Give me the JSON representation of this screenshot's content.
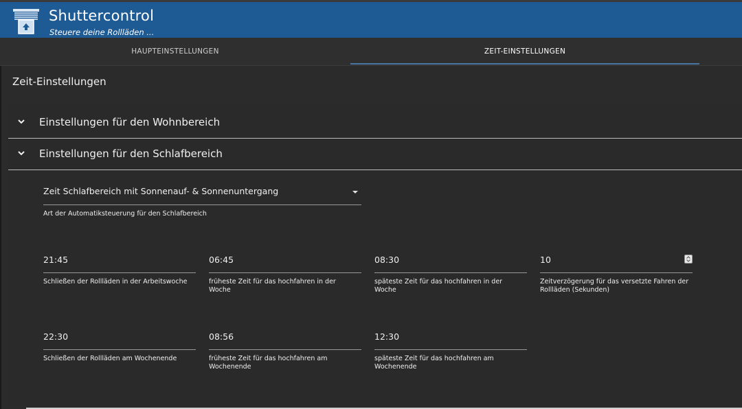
{
  "app": {
    "title": "Shuttercontrol",
    "subtitle": "Steuere deine Rollläden ...",
    "logo_icon": "blinds-up-icon"
  },
  "tabs": [
    {
      "label": "HAUPTEINSTELLUNGEN",
      "active": false
    },
    {
      "label": "ZEIT-EINSTELLUNGEN",
      "active": true
    }
  ],
  "page": {
    "title": "Zeit-Einstellungen"
  },
  "sections": {
    "living": {
      "label": "Einstellungen für den Wohnbereich",
      "icon": "chevron-down-icon"
    },
    "sleep": {
      "label": "Einstellungen für den Schlafbereich",
      "icon": "chevron-down-icon"
    }
  },
  "sleep": {
    "mode_select": {
      "value": "Zeit Schlafbereich mit Sonnenauf- & Sonnenuntergang",
      "helper": "Art der Automatiksteuerung für den Schlafbereich"
    },
    "fields": [
      {
        "value": "21:45",
        "helper": "Schließen der Rollläden in der Arbeitswoche"
      },
      {
        "value": "06:45",
        "helper": "früheste Zeit für das hochfahren in der Woche"
      },
      {
        "value": "08:30",
        "helper": "späteste Zeit für das hochfahren in der Woche"
      },
      {
        "value": "10",
        "helper": "Zeitverzögerung für das versetzte Fahren der Rollläden (Sekunden)"
      },
      {
        "value": "22:30",
        "helper": "Schließen der Rollläden am Wochenende"
      },
      {
        "value": "08:56",
        "helper": "früheste Zeit für das hochfahren am Wochenende"
      },
      {
        "value": "12:30",
        "helper": "späteste Zeit für das hochfahren am Wochenende"
      }
    ]
  },
  "colors": {
    "header": "#1e5a94",
    "tab_indicator": "#4a78a6",
    "background": "#2b2b2b"
  }
}
